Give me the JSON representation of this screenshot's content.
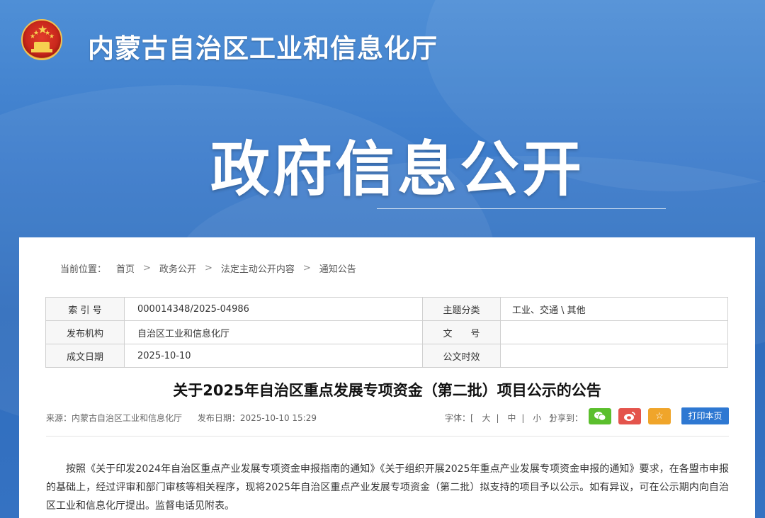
{
  "site": {
    "title": "内蒙古自治区工业和信息化厅",
    "hero_title": "政府信息公开"
  },
  "breadcrumb": {
    "label": "当前位置：",
    "items": [
      "首页",
      "政务公开",
      "法定主动公开内容",
      "通知公告"
    ]
  },
  "meta": {
    "index_label": "索 引 号",
    "index_value": "000014348/2025-04986",
    "topic_label": "主题分类",
    "topic_value": "工业、交通 \\ 其他",
    "org_label": "发布机构",
    "org_value": "自治区工业和信息化厅",
    "doc_no_label": "文　　号",
    "doc_no_value": "",
    "date_label": "成文日期",
    "date_value": "2025-10-10",
    "validity_label": "公文时效",
    "validity_value": ""
  },
  "article": {
    "title": "关于2025年自治区重点发展专项资金（第二批）项目公示的公告",
    "source": "来源：内蒙古自治区工业和信息化厅",
    "published": "发布日期：2025-10-10 15:29",
    "font_label": "字体：[",
    "font_large": "大",
    "font_medium": "中",
    "font_small": "小",
    "font_end": "]",
    "share_label": "分享到：",
    "print_label": "打印本页",
    "body": "按照《关于印发2024年自治区重点产业发展专项资金申报指南的通知》《关于组织开展2025年重点产业发展专项资金申报的通知》要求，在各盟市申报的基础上，经过评审和部门审核等相关程序，现将2025年自治区重点产业发展专项资金（第二批）拟支持的项目予以公示。如有异议，可在公示期内向自治区工业和信息化厅提出。监督电话见附表。"
  },
  "icons": {
    "emblem": "national-emblem-icon",
    "wechat": "wechat-icon",
    "weibo": "weibo-icon",
    "favorite": "star-icon"
  },
  "colors": {
    "banner_blue": "#3c7ccb",
    "print_button": "#2e78d2",
    "wechat_green": "#5bbf2d",
    "weibo_red": "#e4544c",
    "favorite_orange": "#f0a52a"
  }
}
